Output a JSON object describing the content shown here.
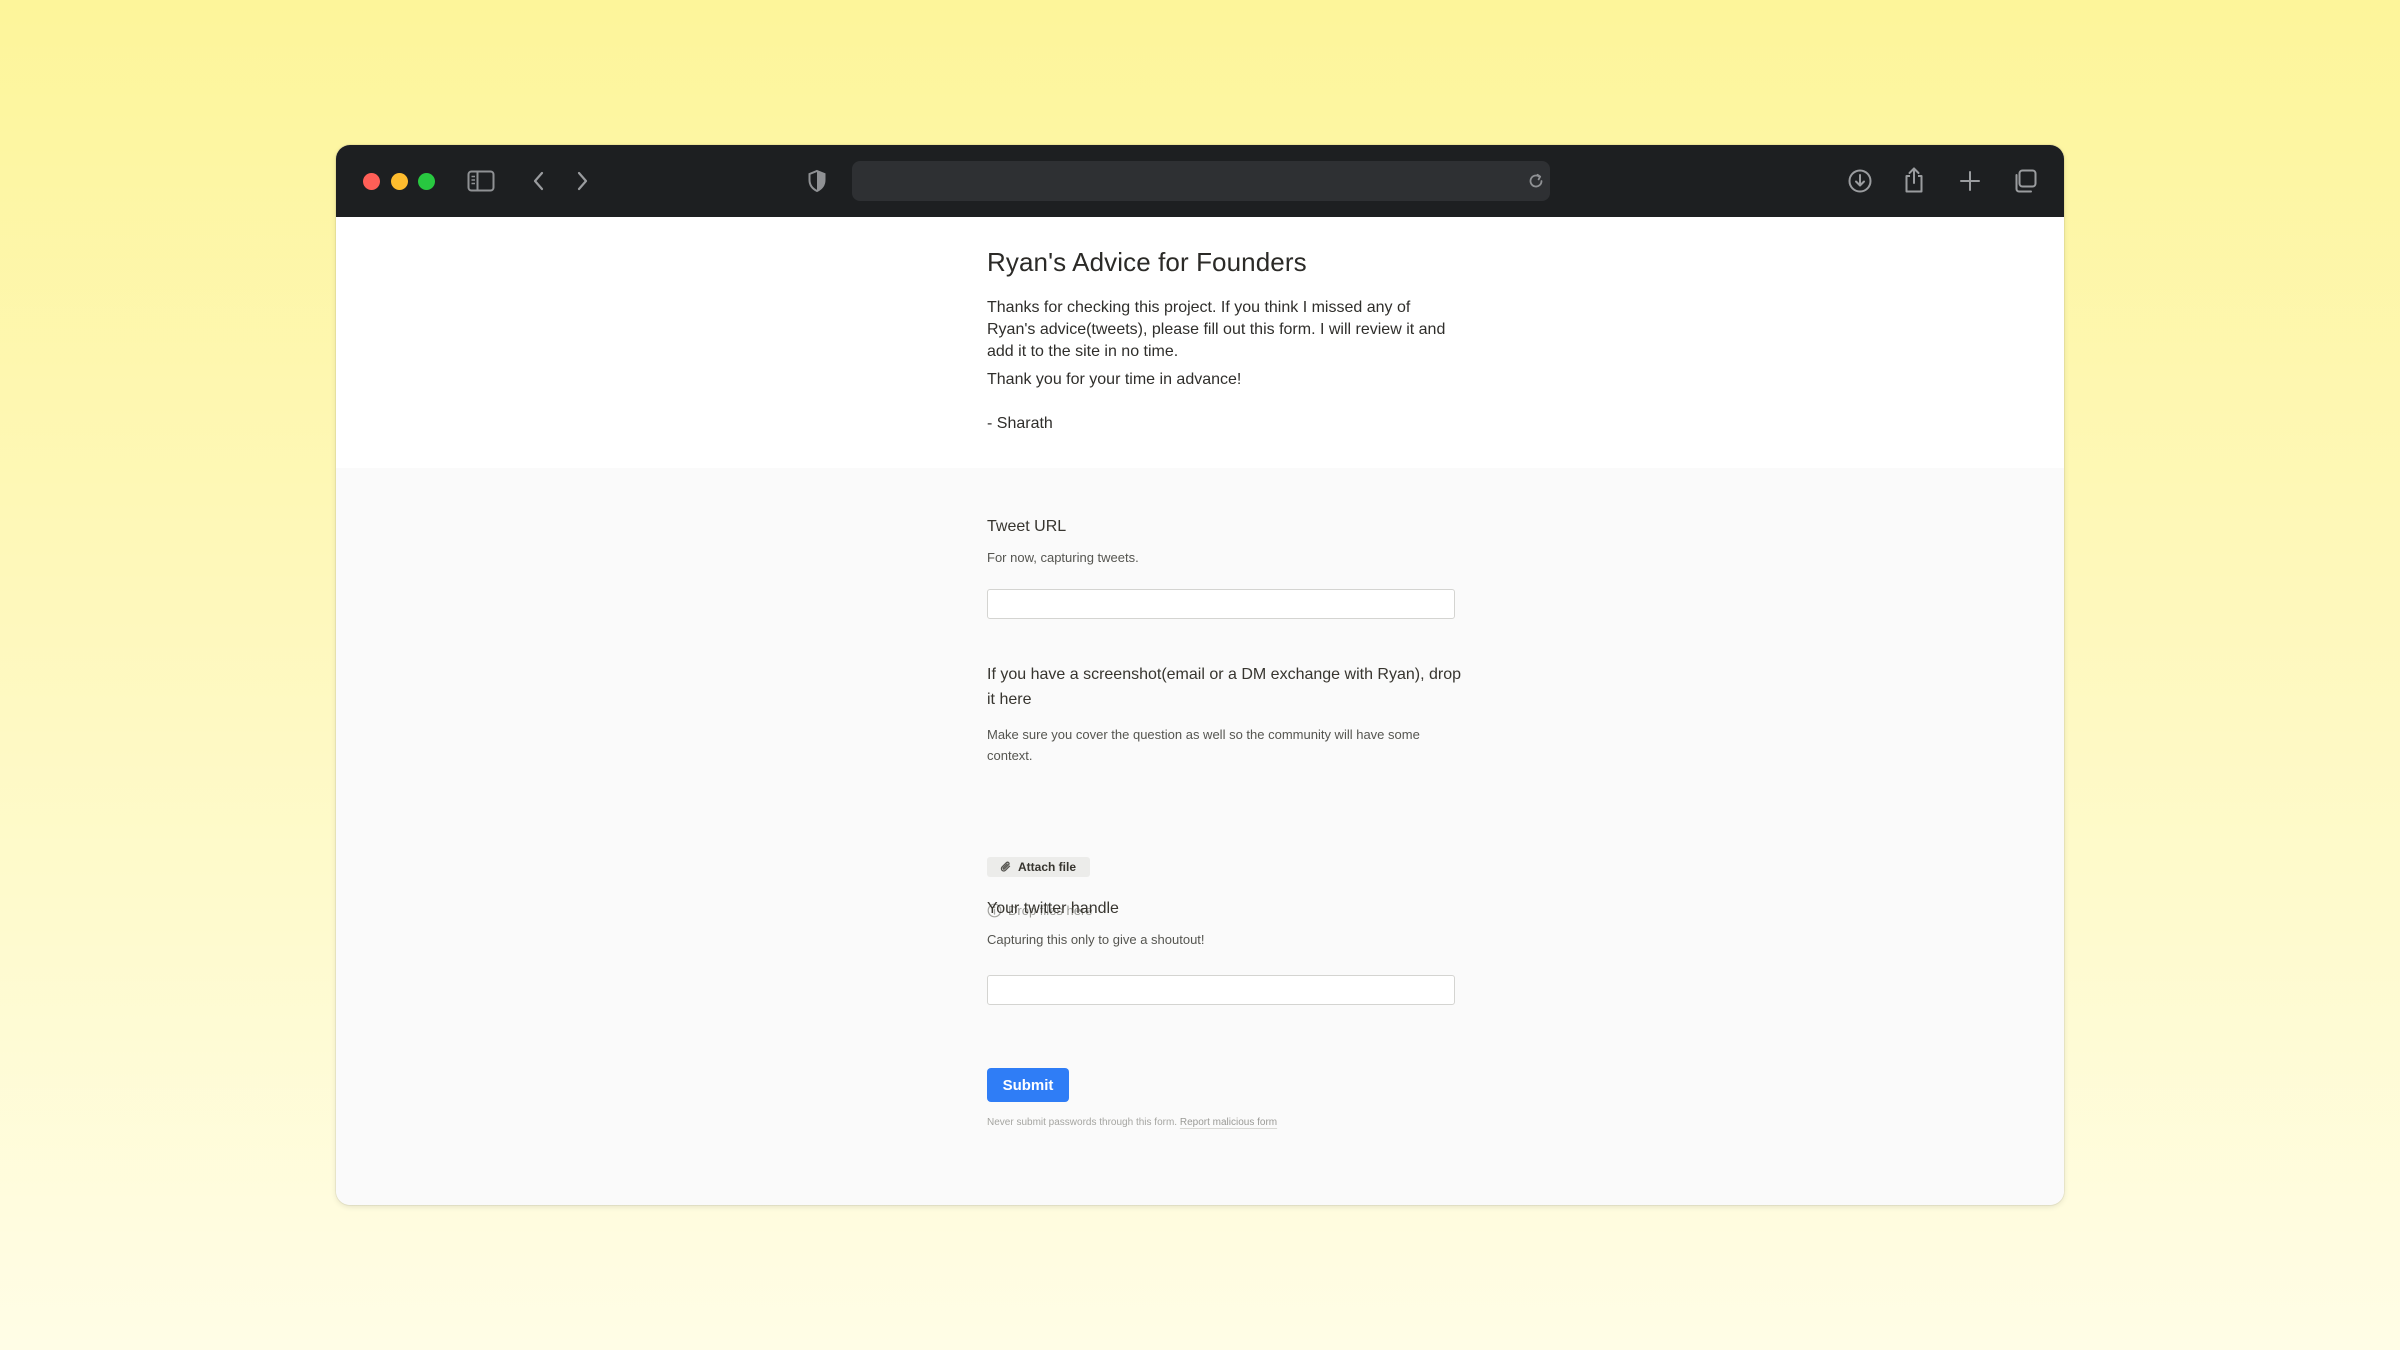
{
  "browser": {
    "url": "",
    "colors": {
      "toolbar": "#1d1f21",
      "urlbar": "#2e3033",
      "close": "#ff5f57",
      "minimize": "#febc2e",
      "zoom": "#28c840"
    },
    "icons": [
      "sidebar-icon",
      "back-icon",
      "forward-icon",
      "shield-icon",
      "reload-icon",
      "download-icon",
      "share-icon",
      "new-tab-icon",
      "tabs-overview-icon"
    ]
  },
  "form": {
    "title": "Ryan's Advice for Founders",
    "description": {
      "intro": "Thanks for checking this project. If you think I missed any of Ryan's advice(tweets), please fill out this form. I will review it and add it to the site in no time.",
      "thanks": "Thank you for your time in advance!",
      "signature": "- Sharath"
    },
    "questions": [
      {
        "label": "Tweet URL",
        "help": "For now, capturing tweets.",
        "value": "",
        "placeholder": ""
      },
      {
        "label": "If you have a screenshot(email or a DM exchange with Ryan), drop it here",
        "help": "Make sure you cover the question as well so the community will have some context.",
        "attach_label": "Attach file",
        "drop_label": "Drop files here"
      },
      {
        "label": "Your twitter handle",
        "help": "Capturing this only to give a shoutout!",
        "value": "",
        "placeholder": ""
      }
    ],
    "submit_label": "Submit",
    "footer": {
      "note": "Never submit passwords through this form.",
      "report_label": "Report malicious form"
    },
    "colors": {
      "accent": "#2f7df6"
    }
  }
}
